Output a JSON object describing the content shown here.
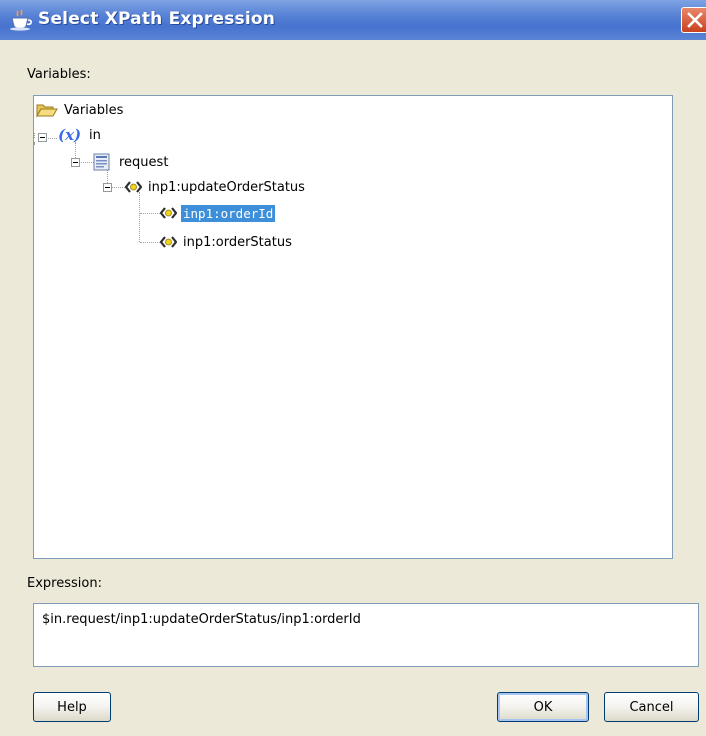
{
  "window": {
    "title": "Select XPath Expression"
  },
  "variables_label": "Variables:",
  "tree": {
    "root": "Variables",
    "in": "in",
    "request": "request",
    "update_order_status": "inp1:updateOrderStatus",
    "order_id": "inp1:orderId",
    "order_status": "inp1:orderStatus"
  },
  "expression": {
    "label": "Expression:",
    "value": "$in.request/inp1:updateOrderStatus/inp1:orderId"
  },
  "buttons": {
    "help": "Help",
    "ok": "OK",
    "cancel": "Cancel"
  },
  "colors": {
    "titlebar": "#4673cf",
    "selection": "#3d8fd9"
  },
  "icons": {
    "title": "java-coffee-cup-icon",
    "root": "open-folder-icon",
    "in": "variable-x-icon",
    "request": "message-part-icon",
    "element": "xml-element-icon"
  },
  "selected_node": "inp1:orderId"
}
